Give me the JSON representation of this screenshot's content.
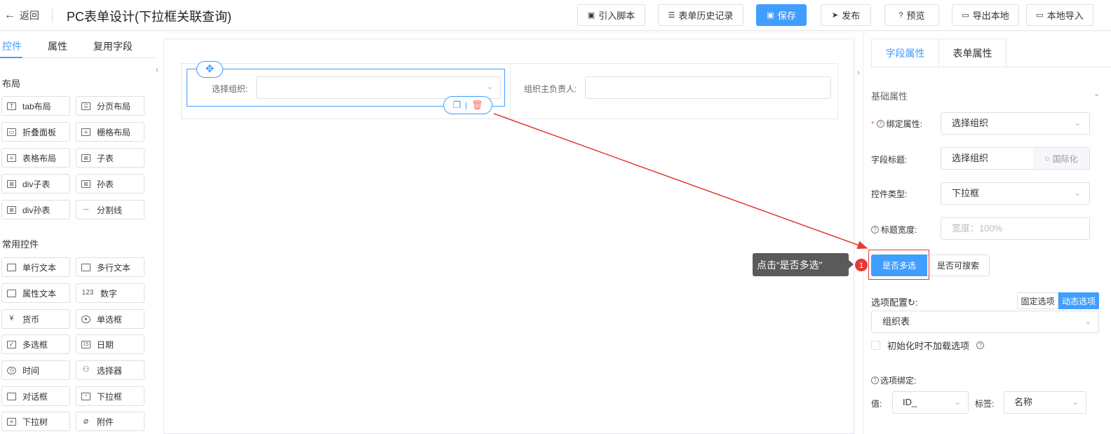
{
  "header": {
    "back_label": "返回",
    "title": "PC表单设计(下拉框关联查询)",
    "buttons": {
      "import_script": "引入脚本",
      "history": "表单历史记录",
      "save": "保存",
      "publish": "发布",
      "preview": "预览",
      "export": "导出本地",
      "import_local": "本地导入"
    }
  },
  "left": {
    "tabs": [
      "控件",
      "属性",
      "复用字段"
    ],
    "section_layout": "布局",
    "layout_items": [
      "tab布局",
      "分页布局",
      "折叠面板",
      "栅格布局",
      "表格布局",
      "子表",
      "div子表",
      "孙表",
      "div孙表",
      "分割线"
    ],
    "section_common": "常用控件",
    "common_items": [
      "单行文本",
      "多行文本",
      "属性文本",
      "数字",
      "货币",
      "单选框",
      "多选框",
      "日期",
      "时间",
      "选择器",
      "对话框",
      "下拉框",
      "下拉树",
      "附件"
    ]
  },
  "canvas": {
    "field1_label": "选择组织:",
    "field2_label": "组织主负责人:"
  },
  "right": {
    "tabs": [
      "字段属性",
      "表单属性"
    ],
    "section_basic": "基础属性",
    "bind_attr_label": "绑定属性:",
    "bind_attr_value": "选择组织",
    "field_title_label": "字段标题:",
    "field_title_value": "选择组织",
    "intl_button": "国际化",
    "control_type_label": "控件类型:",
    "control_type_value": "下拉框",
    "title_width_label": "标题宽度:",
    "title_width_placeholder": "宽度：100%",
    "multi_select": "是否多选",
    "searchable": "是否可搜索",
    "option_config_label": "选项配置",
    "fixed_option": "固定选项",
    "dynamic_option": "动态选项",
    "option_source": "组织表",
    "no_load_label": "初始化时不加载选项",
    "option_binding_label": "选项绑定:",
    "value_label": "值:",
    "value_select": "ID_",
    "tag_label": "标签:",
    "tag_select": "名称"
  },
  "annotation": {
    "tooltip": "点击“是否多选”",
    "step": "1"
  }
}
